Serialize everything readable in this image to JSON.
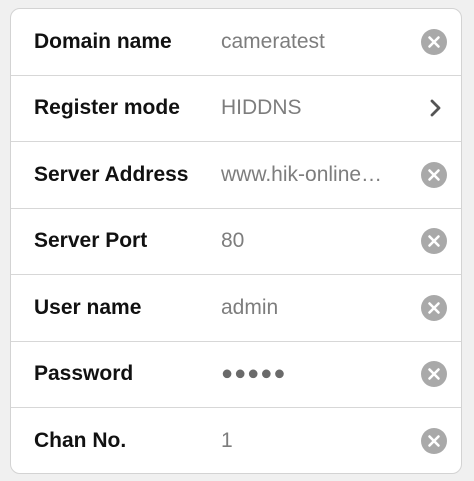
{
  "form": {
    "rows": [
      {
        "label": "Domain name",
        "value": "cameratest",
        "accessory": "clear-icon"
      },
      {
        "label": "Register mode",
        "value": "HIDDNS",
        "accessory": "chevron-right-icon"
      },
      {
        "label": "Server Address",
        "value": "www.hik-online…",
        "accessory": "clear-icon"
      },
      {
        "label": "Server Port",
        "value": "80",
        "accessory": "clear-icon"
      },
      {
        "label": "User name",
        "value": "admin",
        "accessory": "clear-icon"
      },
      {
        "label": "Password",
        "value": "●●●●●",
        "accessory": "clear-icon"
      },
      {
        "label": "Chan No.",
        "value": "1",
        "accessory": "clear-icon"
      }
    ]
  },
  "colors": {
    "label": "#111111",
    "value": "#7d7d7d",
    "clear_button": "#a9a9a9",
    "divider": "#d7d7d7"
  }
}
